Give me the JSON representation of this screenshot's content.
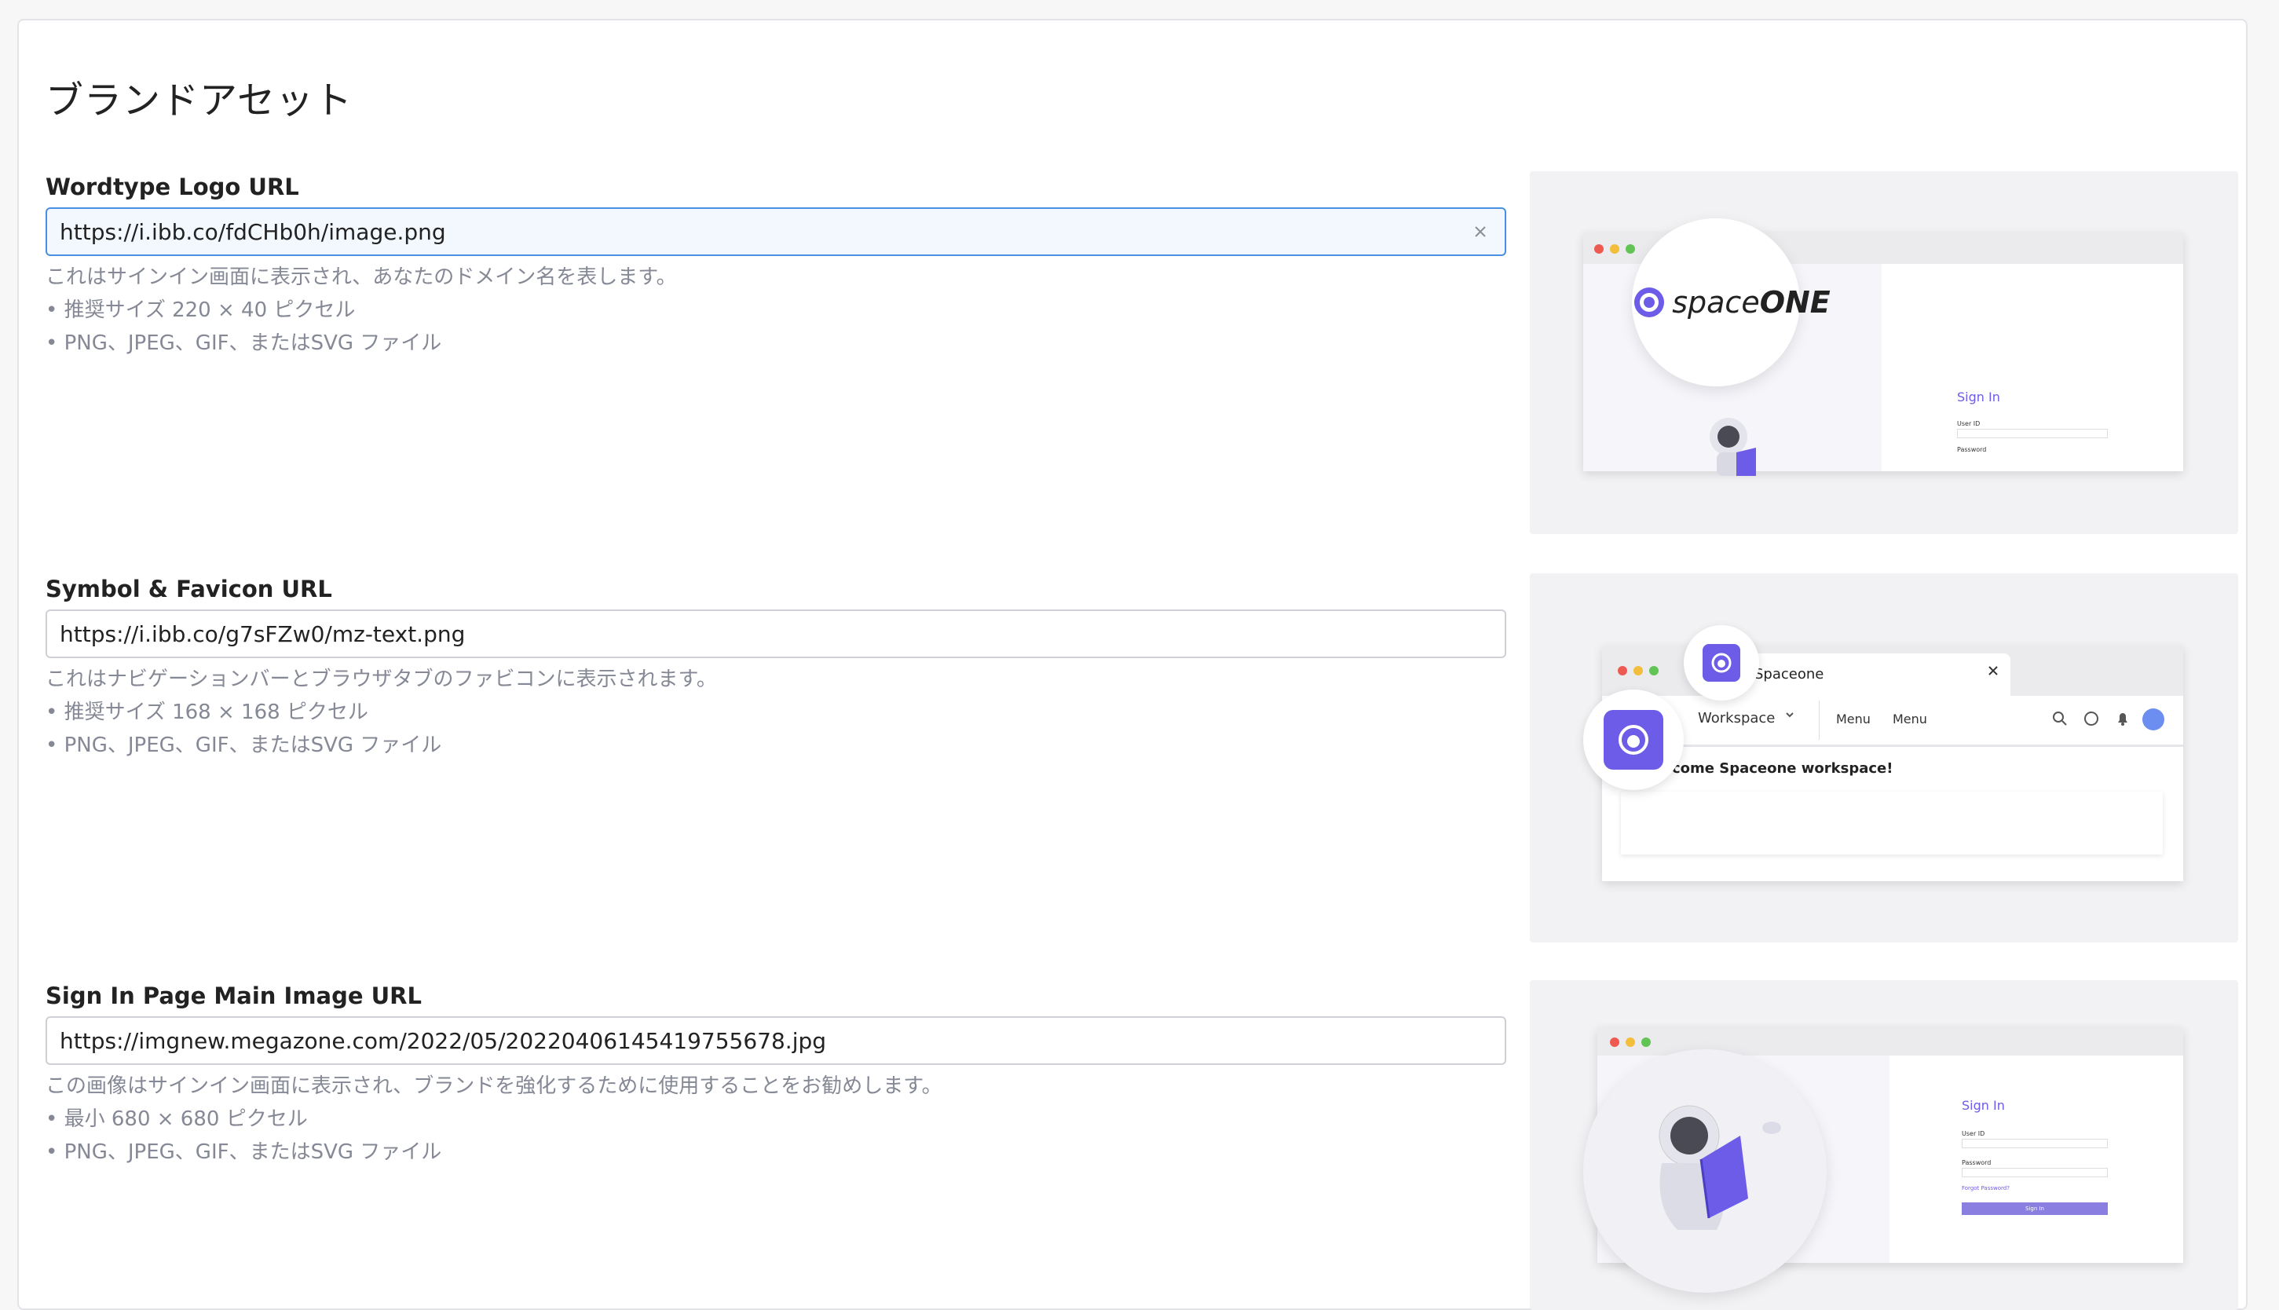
{
  "page": {
    "title": "ブランドアセット"
  },
  "sections": [
    {
      "label": "Wordtype Logo URL",
      "value": "https://i.ibb.co/fdCHb0h/image.png",
      "help": [
        "これはサインイン画面に表示され、あなたのドメイン名を表します。",
        "• 推奨サイズ 220 × 40 ピクセル",
        "• PNG、JPEG、GIF、またはSVG ファイル"
      ]
    },
    {
      "label": "Symbol & Favicon URL",
      "value": "https://i.ibb.co/g7sFZw0/mz-text.png",
      "help": [
        "これはナビゲーションバーとブラウザタブのファビコンに表示されます。",
        "• 推奨サイズ 168 × 168 ピクセル",
        "• PNG、JPEG、GIF、またはSVG ファイル"
      ]
    },
    {
      "label": "Sign In Page Main Image URL",
      "value": "https://imgnew.megazone.com/2022/05/20220406145419755678.jpg",
      "help": [
        "この画像はサインイン画面に表示され、ブランドを強化するために使用することをお勧めします。",
        "• 最小 680 × 680 ピクセル",
        "• PNG、JPEG、GIF、またはSVG ファイル"
      ]
    }
  ],
  "previews": {
    "logo": {
      "brand_thin": "space",
      "brand_bold": "ONE",
      "signin_title": "Sign In",
      "user_id_label": "User ID",
      "password_label": "Password"
    },
    "favicon": {
      "tab_title": "Spaceone",
      "workspace_label": "Workspace",
      "menu_1": "Menu",
      "menu_2": "Menu",
      "welcome": "Welcome Spaceone workspace!"
    },
    "main_image": {
      "signin_title": "Sign In",
      "user_id_label": "User ID",
      "password_label": "Password",
      "forgot": "Forgot Password?",
      "signin_button": "Sign In"
    }
  },
  "colors": {
    "focus_border": "#4a90e2",
    "brand_purple": "#6c5ce7",
    "help_text": "#858895"
  },
  "icons": [
    "close-icon",
    "search-icon",
    "bell-icon",
    "chevron-down-icon",
    "arrow-left-icon",
    "astronaut-icon"
  ]
}
